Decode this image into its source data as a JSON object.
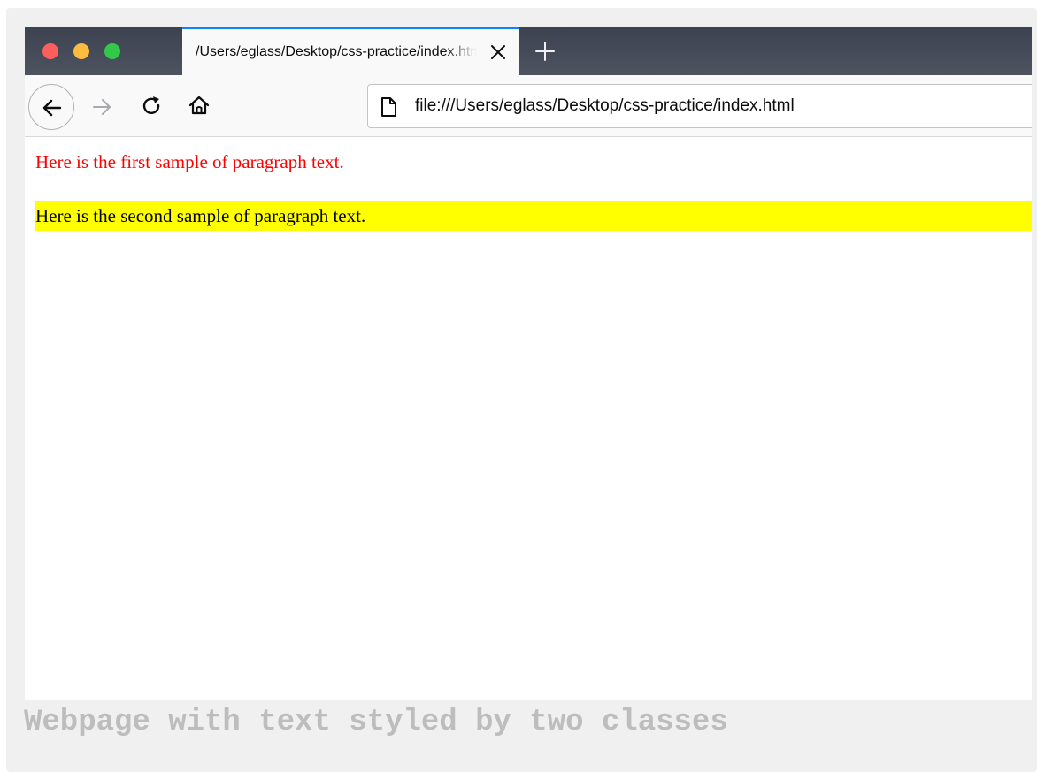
{
  "browser": {
    "tab": {
      "title": "/Users/eglass/Desktop/css-practice/index.html"
    },
    "address_bar": {
      "url": "file:///Users/eglass/Desktop/css-practice/index.html"
    },
    "icons": {
      "traffic_red": "close-window-icon",
      "traffic_yellow": "minimize-window-icon",
      "traffic_green": "zoom-window-icon",
      "tab_close": "close-icon",
      "new_tab": "plus-icon",
      "back": "back-arrow-icon",
      "forward": "forward-arrow-icon",
      "reload": "reload-icon",
      "home": "home-icon",
      "page": "page-icon"
    }
  },
  "page": {
    "paragraph_1": "Here is the first sample of paragraph text.",
    "paragraph_2": "Here is the second sample of paragraph text.",
    "colors": {
      "paragraph_1_text": "#ff0000",
      "paragraph_2_background": "#ffff00"
    }
  },
  "caption": "Webpage with text styled by two classes"
}
